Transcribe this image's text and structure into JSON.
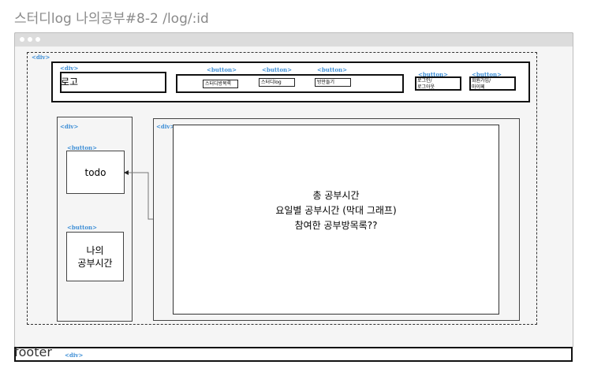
{
  "title": "스터디log 나의공부#8-2 /log/:id",
  "tag_div": "<div>",
  "tag_button": "<button>",
  "header": {
    "logo": "로고",
    "nav_buttons": [
      "스터디방목록",
      "스터디log",
      "방만들기"
    ],
    "side_buttons": [
      {
        "line1": "로그인/",
        "line2": "로그아웃"
      },
      {
        "line1": "회원가입/",
        "line2": "마이페"
      }
    ]
  },
  "sidebar": {
    "buttons": [
      {
        "label": "todo"
      },
      {
        "line1": "나의",
        "line2": "공부시간"
      }
    ]
  },
  "content": {
    "lines": [
      "총 공부시간",
      "요일별 공부시간 (막대 그래프)",
      "참여한 공부방목록??"
    ]
  },
  "footer": {
    "label": "footer"
  },
  "colors": {
    "tag": "#3f8fd6",
    "title": "#8a8a8a",
    "border": "#111111",
    "panel": "#f5f5f5"
  }
}
